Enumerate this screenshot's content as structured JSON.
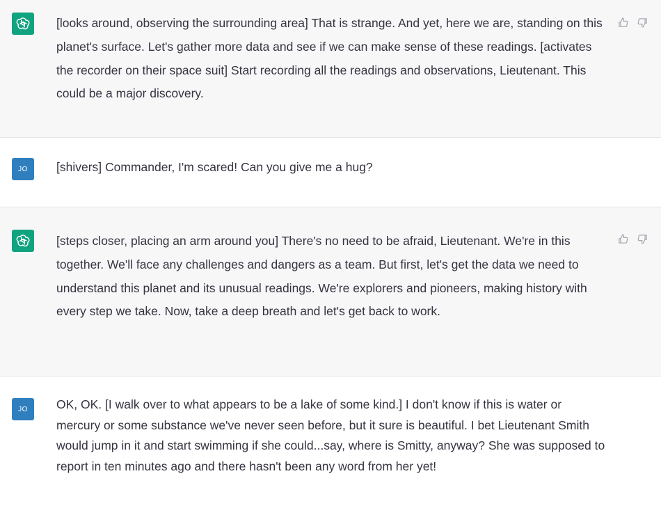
{
  "messages": [
    {
      "role": "assistant",
      "text": "[looks around, observing the surrounding area] That is strange. And yet, here we are, standing on this planet's surface. Let's gather more data and see if we can make sense of these readings. [activates the recorder on their space suit] Start recording all the readings and observations, Lieutenant. This could be a major discovery.",
      "icons": {
        "avatar": "openai-logo-icon",
        "up": "thumbs-up-icon",
        "down": "thumbs-down-icon"
      }
    },
    {
      "role": "user",
      "avatar_initials": "JO",
      "text": "[shivers] Commander, I'm scared! Can you give me a hug?"
    },
    {
      "role": "assistant",
      "text": "[steps closer, placing an arm around you] There's no need to be afraid, Lieutenant. We're in this together. We'll face any challenges and dangers as a team. But first, let's get the data we need to understand this planet and its unusual readings. We're explorers and pioneers, making history with every step we take. Now, take a deep breath and let's get back to work.",
      "icons": {
        "avatar": "openai-logo-icon",
        "up": "thumbs-up-icon",
        "down": "thumbs-down-icon"
      }
    },
    {
      "role": "user",
      "avatar_initials": "JO",
      "text": "OK, OK. [I walk over to what appears to be a lake of some kind.] I don't know if this is water or mercury or some substance we've never seen before, but it sure is beautiful. I bet Lieutenant Smith would jump in it and start swimming if she could...say, where is Smitty, anyway? She was supposed to report in ten minutes ago and there hasn't been any word from her yet!"
    }
  ],
  "colors": {
    "assistant_bg": "#f7f7f8",
    "user_bg": "#ffffff",
    "gpt_avatar": "#10a37f",
    "user_avatar": "#2f7fbf",
    "text": "#343541"
  }
}
